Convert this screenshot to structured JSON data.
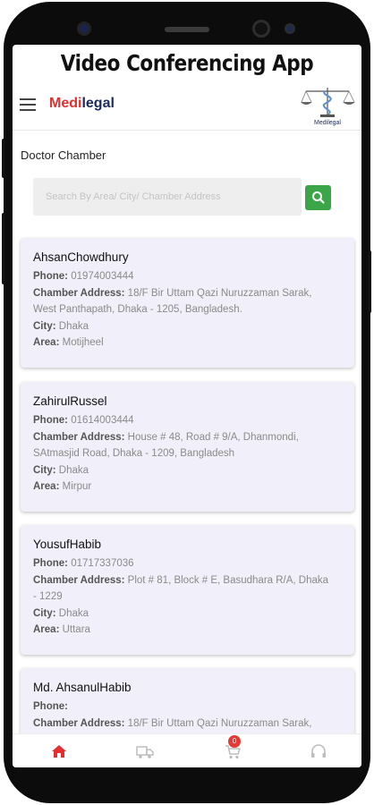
{
  "banner": {
    "title": "Video Conferencing App"
  },
  "header": {
    "brand_part1": "Medi",
    "brand_part2": "legal",
    "logo_caption": "Medilegal",
    "menu_icon": "hamburger-icon"
  },
  "page": {
    "section_title": "Doctor Chamber"
  },
  "search": {
    "placeholder": "Search By Area/ City/ Chamber Address",
    "button_icon": "search-icon"
  },
  "labels": {
    "phone": "Phone:",
    "chamber_address": "Chamber Address:",
    "city": "City:",
    "area": "Area:"
  },
  "doctors": [
    {
      "name": "AhsanChowdhury",
      "phone": "01974003444",
      "address_line1": "18/F Bir Uttam Qazi Nuruzzaman Sarak,",
      "address_line2": "West Panthapath, Dhaka - 1205, Bangladesh.",
      "city": "Dhaka",
      "area": "Motijheel"
    },
    {
      "name": "ZahirulRussel",
      "phone": "01614003444",
      "address_line1": "House # 48, Road # 9/A, Dhanmondi,",
      "address_line2": "SAtmasjid Road, Dhaka - 1209, Bangladesh",
      "city": "Dhaka",
      "area": "Mirpur"
    },
    {
      "name": "YousufHabib",
      "phone": "01717337036",
      "address_line1": "Plot # 81, Block # E, Basudhara R/A, Dhaka",
      "address_line2": "- 1229",
      "city": "Dhaka",
      "area": "Uttara"
    },
    {
      "name": "Md. AhsanulHabib",
      "phone": "",
      "address_line1": "18/F Bir Uttam Qazi Nuruzzaman Sarak,",
      "address_line2": "",
      "city": "",
      "area": ""
    }
  ],
  "bottom_nav": {
    "items": [
      "home-icon",
      "truck-icon",
      "cart-icon",
      "headset-icon"
    ],
    "cart_badge": "0",
    "active_color": "#e52e2e",
    "inactive_color": "#bdbdbd"
  },
  "colors": {
    "brand_red": "#e52e2e",
    "search_green": "#3aa648",
    "card_bg": "#f1f0fa"
  }
}
